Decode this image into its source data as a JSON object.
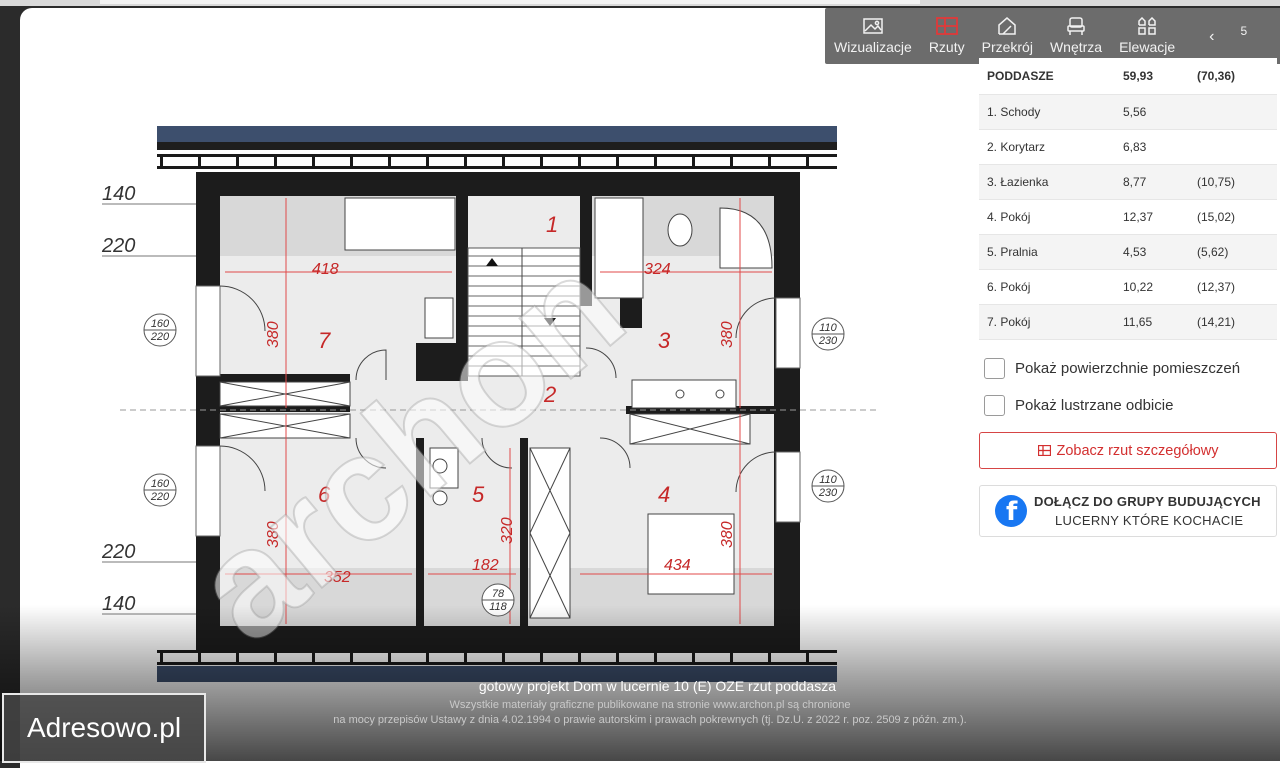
{
  "tabs": [
    {
      "label": "Wizualizacje",
      "icon": "image-icon"
    },
    {
      "label": "Rzuty",
      "icon": "floorplan-icon"
    },
    {
      "label": "Przekrój",
      "icon": "house-section-icon"
    },
    {
      "label": "Wnętrza",
      "icon": "armchair-icon"
    },
    {
      "label": "Elewacje",
      "icon": "facades-icon"
    }
  ],
  "tab_prev_glyph": "‹",
  "tab_more_glyph": "5",
  "accent_color": "#e03a3a",
  "area_table": {
    "header": {
      "name": "PODDASZE",
      "area": "59,93",
      "area_total": "(70,36)"
    },
    "rows": [
      {
        "name": "1. Schody",
        "area": "5,56",
        "area_total": ""
      },
      {
        "name": "2. Korytarz",
        "area": "6,83",
        "area_total": ""
      },
      {
        "name": "3. Łazienka",
        "area": "8,77",
        "area_total": "(10,75)"
      },
      {
        "name": "4. Pokój",
        "area": "12,37",
        "area_total": "(15,02)"
      },
      {
        "name": "5. Pralnia",
        "area": "4,53",
        "area_total": "(5,62)"
      },
      {
        "name": "6. Pokój",
        "area": "10,22",
        "area_total": "(12,37)"
      },
      {
        "name": "7. Pokój",
        "area": "11,65",
        "area_total": "(14,21)"
      }
    ]
  },
  "checkboxes": {
    "show_areas": "Pokaż powierzchnie pomieszczeń",
    "mirror": "Pokaż lustrzane odbicie"
  },
  "detail_button": "Zobacz rzut szczegółowy",
  "facebook": {
    "line1": "DOŁĄCZ DO GRUPY BUDUJĄCYCH",
    "line2": "LUCERNY KTÓRE KOCHACIE",
    "logo_glyph": "f"
  },
  "plan": {
    "room_numbers": [
      "1",
      "2",
      "3",
      "4",
      "5",
      "6",
      "7"
    ],
    "dims": [
      "418",
      "324",
      "380",
      "380",
      "380",
      "380",
      "380",
      "352",
      "182",
      "320",
      "434"
    ],
    "left_heights": [
      "140",
      "220",
      "220",
      "140"
    ],
    "windows": [
      {
        "top": "160",
        "bottom": "220"
      },
      {
        "top": "110",
        "bottom": "230"
      },
      {
        "top": "160",
        "bottom": "220"
      },
      {
        "top": "110",
        "bottom": "230"
      },
      {
        "top": "78",
        "bottom": "118"
      }
    ],
    "watermark_text": "archon"
  },
  "caption": "gotowy projekt Dom w lucernie 10 (E) OZE rzut poddasza",
  "legal_line1": "Wszystkie materiały graficzne publikowane na stronie www.archon.pl są chronione",
  "legal_line2": "na mocy przepisów Ustawy z dnia 4.02.1994 o prawie autorskim i prawach pokrewnych (tj. Dz.U. z 2022 r. poz. 2509 z późn. zm.).",
  "site_watermark": "Adresowo.pl"
}
